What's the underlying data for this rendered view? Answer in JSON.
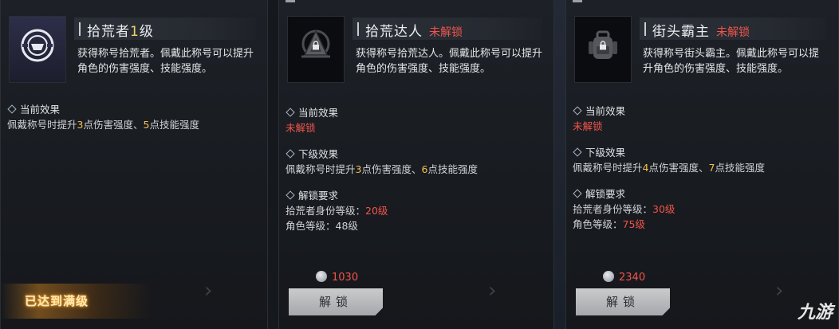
{
  "cards": [
    {
      "title": "拾荒者",
      "title_level": "1",
      "title_suffix": "级",
      "icon": "scavenger-emblem-icon",
      "description": "获得称号拾荒者。佩戴此称号可以提升角色的伤害强度、技能强度。",
      "current_effect_label": "当前效果",
      "current_effect_parts": [
        "佩戴称号时提升",
        "3",
        "点伤害强度、",
        "5",
        "点技能强度"
      ],
      "status_badge": "已达到满级"
    },
    {
      "title": "拾荒达人",
      "locked_label": "未解锁",
      "icon": "pyramid-emblem-icon",
      "description": "获得称号拾荒达人。佩戴此称号可以提升角色的伤害强度、技能强度。",
      "current_effect_label": "当前效果",
      "current_effect_value": "未解锁",
      "next_effect_label": "下级效果",
      "next_effect_parts": [
        "佩戴称号时提升",
        "3",
        "点伤害强度、",
        "6",
        "点技能强度"
      ],
      "unlock_req_label": "解锁要求",
      "req1_label": "拾荒者身份等级：",
      "req1_value": "20级",
      "req2_label": "角色等级：",
      "req2_value": "48级",
      "cost": "1030",
      "unlock_button": "解锁"
    },
    {
      "title": "街头霸主",
      "locked_label": "未解锁",
      "icon": "backpack-emblem-icon",
      "description": "获得称号街头霸主。佩戴此称号可以提升角色的伤害强度、技能强度。",
      "current_effect_label": "当前效果",
      "current_effect_value": "未解锁",
      "next_effect_label": "下级效果",
      "next_effect_parts": [
        "佩戴称号时提升",
        "4",
        "点伤害强度、",
        "7",
        "点技能强度"
      ],
      "unlock_req_label": "解锁要求",
      "req1_label": "拾荒者身份等级：",
      "req1_value": "30级",
      "req2_label": "角色等级：",
      "req2_value": "75级",
      "cost": "2340",
      "unlock_button": "解锁"
    }
  ],
  "watermark": "九游",
  "colors": {
    "accent_yellow": "#f2c14e",
    "locked_red": "#f0554b",
    "button_gray": "#b8babd"
  }
}
